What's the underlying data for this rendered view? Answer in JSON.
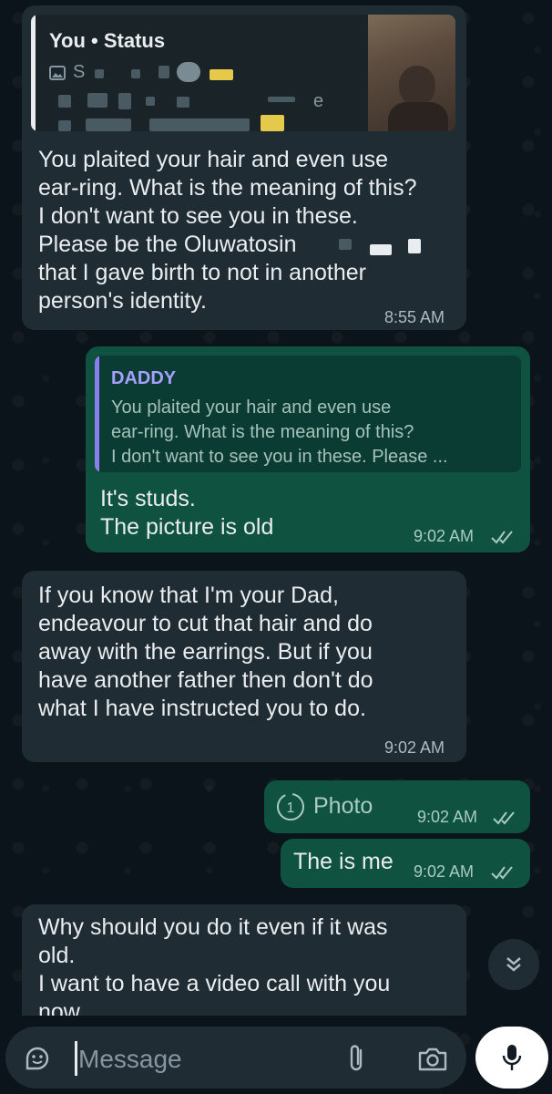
{
  "messages": {
    "m1": {
      "quote_title": "You • Status",
      "quote_sub": "S",
      "quote_sub2": "e",
      "text": "You plaited your hair and even use\near-ring. What is the meaning of this?\nI don't want to see you in these.\nPlease be the Oluwatosin\nthat I gave birth to not in another\nperson's identity.",
      "time": "8:55 AM"
    },
    "m2": {
      "quote_name": "DADDY",
      "quote_text": "You plaited your hair and even use\near-ring. What is the meaning of this?\nI don't want to see you in these. Please ...",
      "text": "It's studs.\nThe picture is old",
      "time": "9:02 AM"
    },
    "m3": {
      "text": "If you know that I'm your Dad,\nendeavour to cut that hair and do\naway with the earrings. But if you\nhave another father then don't do\nwhat I have instructed you to do.",
      "time": "9:02 AM"
    },
    "m4": {
      "label": "Photo",
      "time": "9:02 AM"
    },
    "m5": {
      "text": "The is me",
      "time": "9:02 AM"
    },
    "m6": {
      "text": "Why should you do it even if it was\nold.\nI want to have a video call with you\nnow"
    }
  },
  "composer": {
    "placeholder": "Message"
  },
  "colors": {
    "incoming_bubble": "#202c33",
    "outgoing_bubble": "#0f5240",
    "background": "#0b141a",
    "read_ticks": "#a9cbc2"
  },
  "icons": [
    "image-icon",
    "double-check-icon",
    "sticker-icon",
    "paperclip-icon",
    "camera-icon",
    "mic-icon",
    "chevron-double-down-icon",
    "view-once-icon"
  ]
}
